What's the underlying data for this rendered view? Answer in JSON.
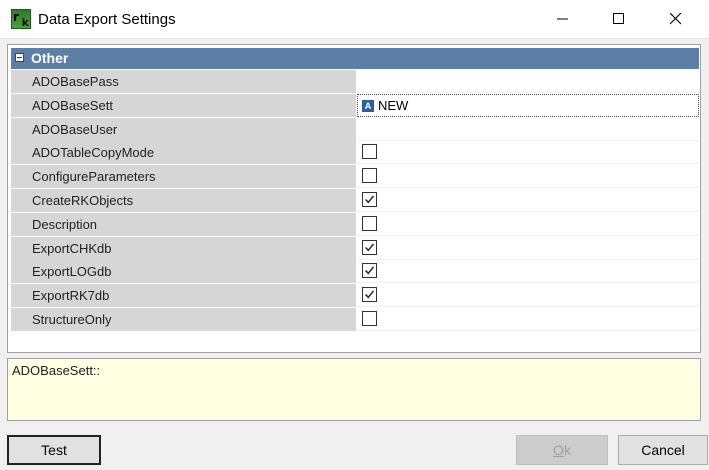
{
  "window": {
    "title": "Data Export Settings",
    "icon": "rk-app-icon",
    "icon_letters": {
      "left": "r",
      "right": "k"
    }
  },
  "grid": {
    "category": "Other",
    "properties": [
      {
        "name": "ADOBasePass",
        "type": "text",
        "value": ""
      },
      {
        "name": "ADOBaseSett",
        "type": "text",
        "value": "NEW",
        "icon": "ado-letter-icon",
        "icon_glyph": "A",
        "selected": true
      },
      {
        "name": "ADOBaseUser",
        "type": "text",
        "value": ""
      },
      {
        "name": "ADOTableCopyMode",
        "type": "checkbox",
        "checked": false
      },
      {
        "name": "ConfigureParameters",
        "type": "checkbox",
        "checked": false
      },
      {
        "name": "CreateRKObjects",
        "type": "checkbox",
        "checked": true
      },
      {
        "name": "Description",
        "type": "checkbox",
        "checked": false
      },
      {
        "name": "ExportCHKdb",
        "type": "checkbox",
        "checked": true
      },
      {
        "name": "ExportLOGdb",
        "type": "checkbox",
        "checked": true
      },
      {
        "name": "ExportRK7db",
        "type": "checkbox",
        "checked": true
      },
      {
        "name": "StructureOnly",
        "type": "checkbox",
        "checked": false
      }
    ]
  },
  "description": "ADOBaseSett::",
  "buttons": {
    "test": "Test",
    "ok": "Ok",
    "ok_accel_prefix": "",
    "ok_accel_char": "O",
    "ok_accel_rest": "k",
    "cancel": "Cancel"
  },
  "colors": {
    "category_header": "#5b7fa6",
    "name_cell": "#d6d6d6",
    "description_bg": "#ffffe1"
  }
}
